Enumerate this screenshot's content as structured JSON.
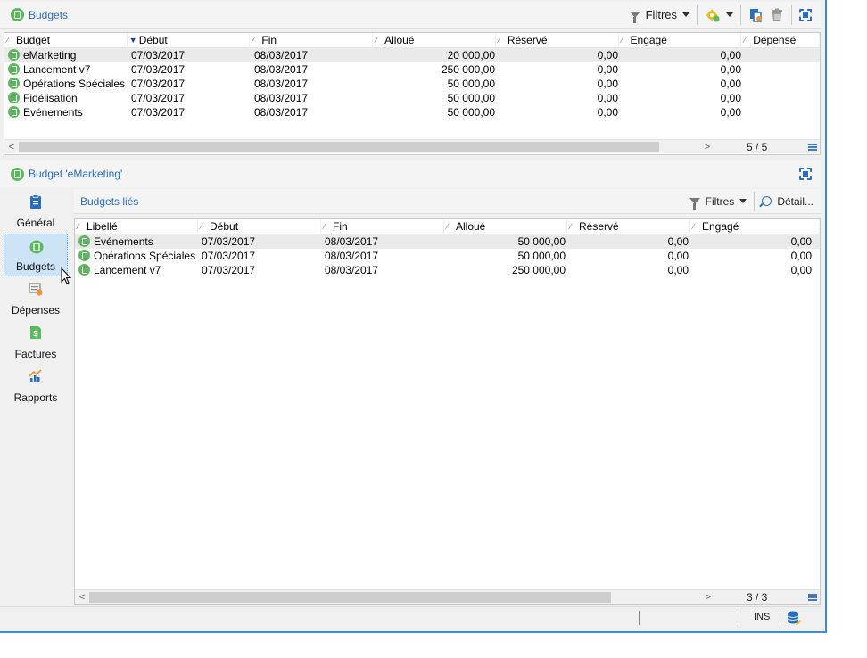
{
  "colors": {
    "accent": "#2a6ebb",
    "budget_icon": "#5cb85c",
    "border_blue": "#3c8ad8"
  },
  "top_panel": {
    "title": "Budgets",
    "toolbar": {
      "filter_label": "Filtres",
      "icons": [
        "funnel-icon",
        "gear-new-icon",
        "copy-icon",
        "trash-icon",
        "maximize-icon"
      ]
    },
    "columns": [
      "Budget",
      "Début",
      "Fin",
      "Alloué",
      "Réservé",
      "Engagé",
      "Dépensé"
    ],
    "rows": [
      {
        "name": "eMarketing",
        "debut": "07/03/2017",
        "fin": "08/03/2017",
        "alloue": "20 000,00",
        "reserve": "0,00",
        "engage": "0,00"
      },
      {
        "name": "Lancement v7",
        "debut": "07/03/2017",
        "fin": "08/03/2017",
        "alloue": "250 000,00",
        "reserve": "0,00",
        "engage": "0,00"
      },
      {
        "name": "Opérations Spéciales",
        "debut": "07/03/2017",
        "fin": "08/03/2017",
        "alloue": "50 000,00",
        "reserve": "0,00",
        "engage": "0,00"
      },
      {
        "name": "Fidélisation",
        "debut": "07/03/2017",
        "fin": "08/03/2017",
        "alloue": "50 000,00",
        "reserve": "0,00",
        "engage": "0,00"
      },
      {
        "name": "Evénements",
        "debut": "07/03/2017",
        "fin": "08/03/2017",
        "alloue": "50 000,00",
        "reserve": "0,00",
        "engage": "0,00"
      }
    ],
    "pager": "5 / 5"
  },
  "detail_panel": {
    "title": "Budget 'eMarketing'",
    "sidebar": [
      {
        "label": "Général",
        "icon": "clipboard-icon"
      },
      {
        "label": "Budgets",
        "icon": "budget-icon"
      },
      {
        "label": "Dépenses",
        "icon": "expenses-icon"
      },
      {
        "label": "Factures",
        "icon": "invoice-icon"
      },
      {
        "label": "Rapports",
        "icon": "chart-icon"
      }
    ],
    "sub_title": "Budgets liés",
    "sub_toolbar": {
      "filter_label": "Filtres",
      "detail_label": "Détail..."
    },
    "columns": [
      "Libellé",
      "Début",
      "Fin",
      "Alloué",
      "Réservé",
      "Engagé"
    ],
    "rows": [
      {
        "name": "Evénements",
        "debut": "07/03/2017",
        "fin": "08/03/2017",
        "alloue": "50 000,00",
        "reserve": "0,00",
        "engage": "0,00"
      },
      {
        "name": "Opérations Spéciales",
        "debut": "07/03/2017",
        "fin": "08/03/2017",
        "alloue": "50 000,00",
        "reserve": "0,00",
        "engage": "0,00"
      },
      {
        "name": "Lancement v7",
        "debut": "07/03/2017",
        "fin": "08/03/2017",
        "alloue": "250 000,00",
        "reserve": "0,00",
        "engage": "0,00"
      }
    ],
    "pager": "3 / 3"
  },
  "statusbar": {
    "mode": "INS"
  }
}
